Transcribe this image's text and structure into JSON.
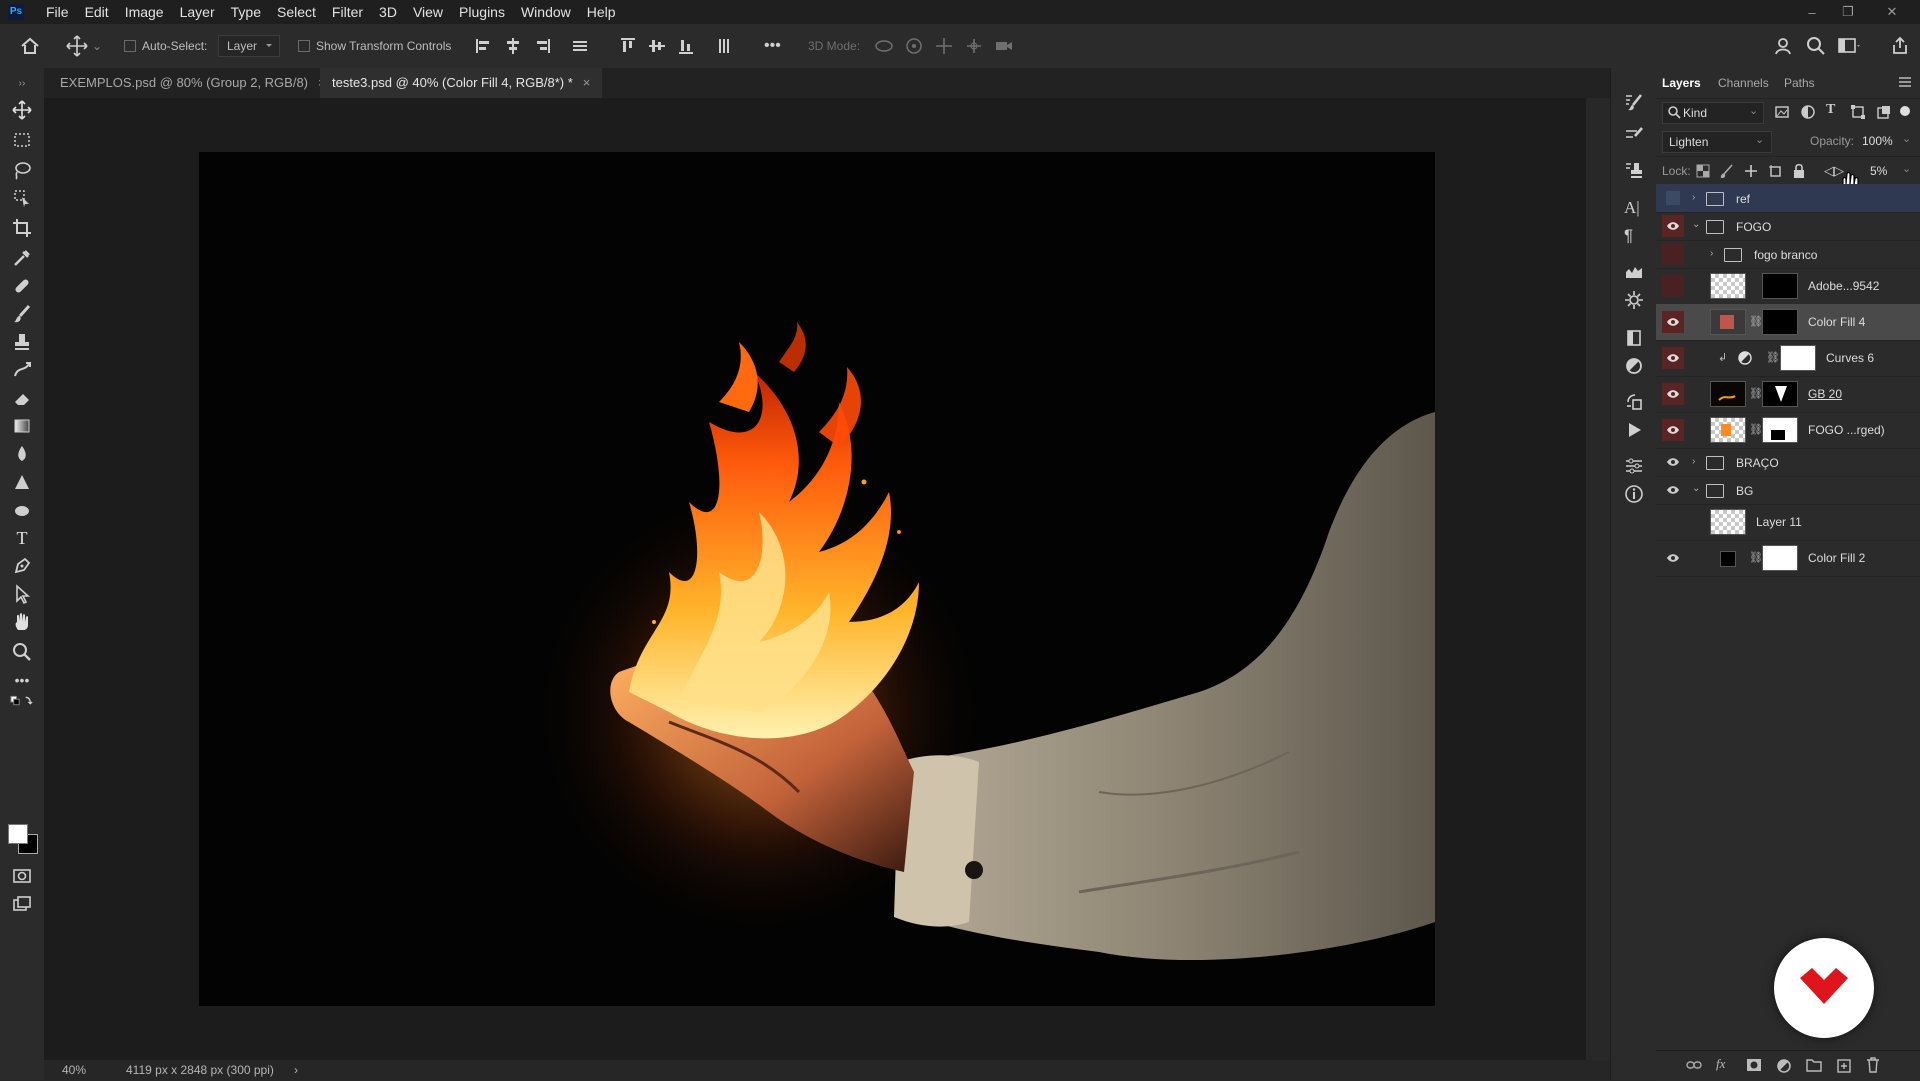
{
  "app": {
    "logo": "Ps"
  },
  "menu": [
    "File",
    "Edit",
    "Image",
    "Layer",
    "Type",
    "Select",
    "Filter",
    "3D",
    "View",
    "Plugins",
    "Window",
    "Help"
  ],
  "options_bar": {
    "auto_select_label": "Auto-Select:",
    "auto_select_value": "Layer",
    "show_transform_label": "Show Transform Controls",
    "three_d_mode_label": "3D Mode:",
    "more": "•••"
  },
  "tabs": [
    {
      "label": "EXEMPLOS.psd @ 80% (Group 2, RGB/8)",
      "active": false
    },
    {
      "label": "teste3.psd @ 40% (Color Fill 4, RGB/8*) *",
      "active": true
    }
  ],
  "status": {
    "zoom": "40%",
    "doc_info": "4119 px x 2848 px (300 ppi)",
    "arrow": "›"
  },
  "layers_panel": {
    "tabs": [
      "Layers",
      "Channels",
      "Paths"
    ],
    "filter_kind": "Kind",
    "blend_mode": "Lighten",
    "opacity_label": "Opacity:",
    "opacity_value": "100%",
    "lock_label": "Lock:",
    "fill_value": "5%",
    "layers": [
      {
        "name": "ref",
        "type": "group",
        "visible": false,
        "indent": 0,
        "expanded": false,
        "selected_hint": true
      },
      {
        "name": "FOGO",
        "type": "group",
        "visible": true,
        "indent": 0,
        "expanded": true
      },
      {
        "name": "fogo branco",
        "type": "group",
        "visible": false,
        "indent": 1,
        "expanded": false
      },
      {
        "name": "Adobe...9542",
        "type": "smart",
        "visible": false,
        "indent": 1
      },
      {
        "name": "Color Fill 4",
        "type": "fill",
        "visible": true,
        "indent": 1,
        "selected": true,
        "fill_color": "#c0564a"
      },
      {
        "name": "Curves 6",
        "type": "adjust",
        "visible": true,
        "indent": 1
      },
      {
        "name": "GB 20",
        "type": "smart",
        "visible": true,
        "indent": 1
      },
      {
        "name": "FOGO ...rged)",
        "type": "smart",
        "visible": true,
        "indent": 1
      },
      {
        "name": "BRAÇO",
        "type": "group",
        "visible": true,
        "indent": 0,
        "expanded": false
      },
      {
        "name": "BG",
        "type": "group",
        "visible": true,
        "indent": 0,
        "expanded": true
      },
      {
        "name": "Layer 11",
        "type": "pixel",
        "visible": false,
        "indent": 1
      },
      {
        "name": "Color Fill 2",
        "type": "fill",
        "visible": true,
        "indent": 1,
        "fill_color": "#000000"
      }
    ]
  },
  "colors": {
    "accent_selected": "#4a4a4a",
    "visible_eye_bg": "#6a2a2a",
    "badge_red": "#e0141b"
  }
}
